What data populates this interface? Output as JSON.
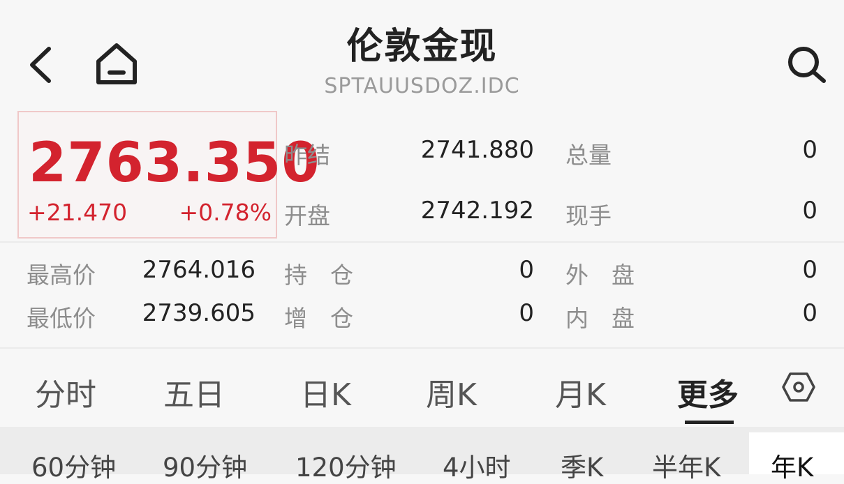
{
  "header": {
    "title": "伦敦金现",
    "subtitle": "SPTAUUSDOZ.IDC",
    "back_icon": "chevron-left-icon",
    "home_icon": "home-icon",
    "search_icon": "search-icon"
  },
  "quote": {
    "price": "2763.350",
    "change": "+21.470",
    "change_pct": "+0.78%",
    "up_color": "#d3232e"
  },
  "stats_top": [
    {
      "label": "昨结",
      "value": "2741.880",
      "label2": "总量",
      "value2": "0"
    },
    {
      "label": "开盘",
      "value": "2742.192",
      "label2": "现手",
      "value2": "0"
    }
  ],
  "stats_bottom": [
    {
      "label": "最高价",
      "value": "2764.016",
      "label2": "持　仓",
      "value2": "0",
      "label3": "外　盘",
      "value3": "0"
    },
    {
      "label": "最低价",
      "value": "2739.605",
      "label2": "增　仓",
      "value2": "0",
      "label3": "内　盘",
      "value3": "0"
    }
  ],
  "tabs": [
    "分时",
    "五日",
    "日K",
    "周K",
    "月K",
    "更多"
  ],
  "active_tab": "更多",
  "settings_icon": "hexagon-settings-icon",
  "sub_tabs": [
    "60分钟",
    "90分钟",
    "120分钟",
    "4小时",
    "季K",
    "半年K",
    "年K"
  ],
  "active_sub_tab": "年K"
}
